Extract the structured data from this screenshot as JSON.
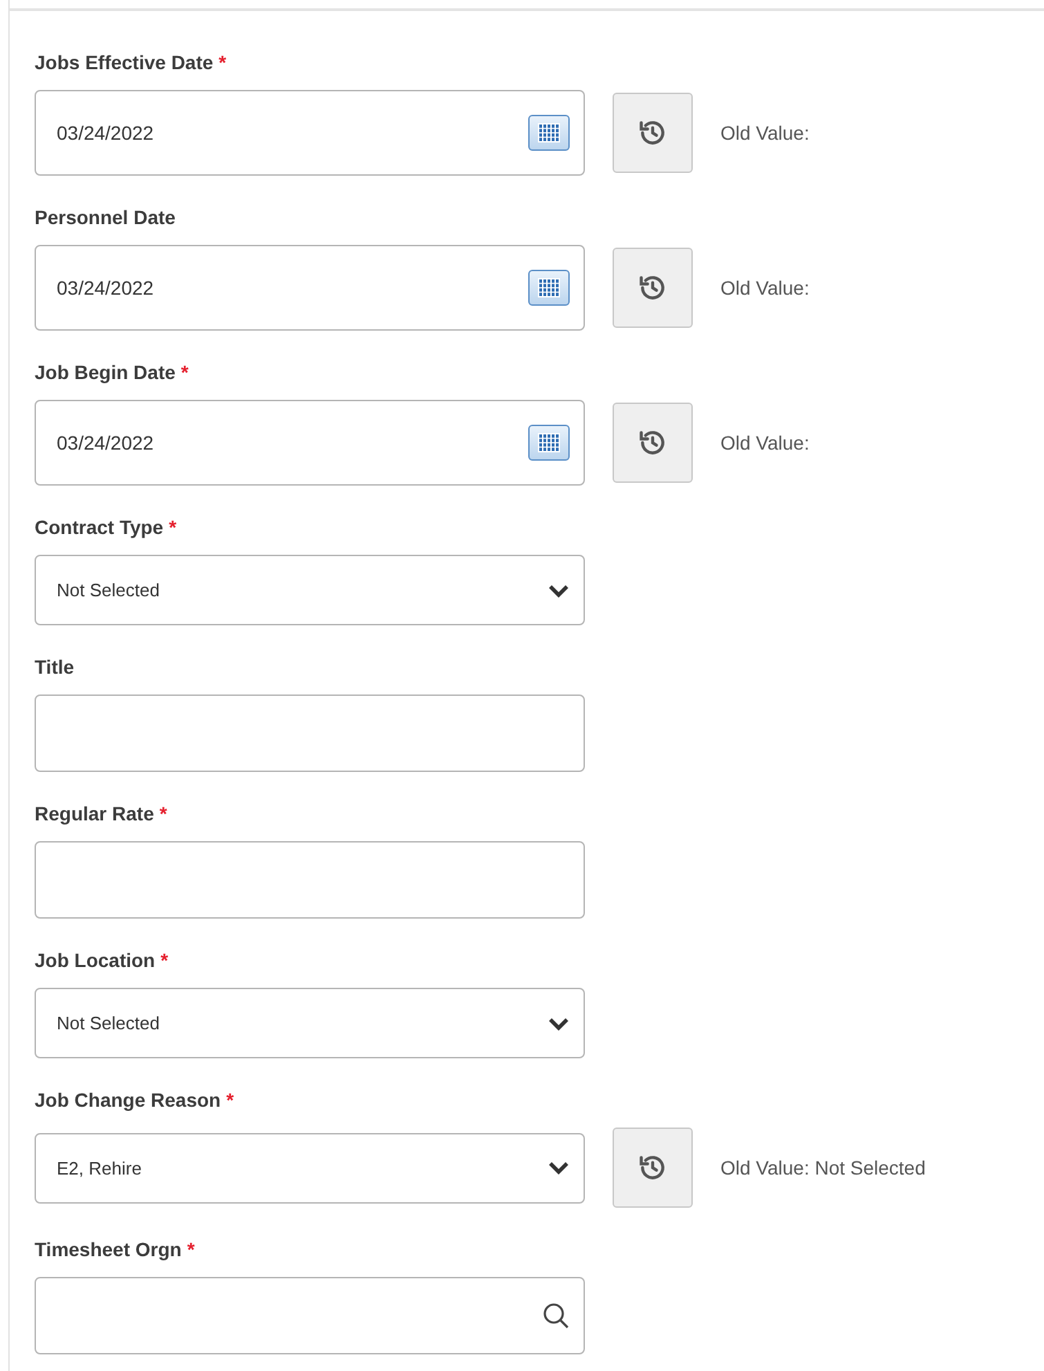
{
  "fields": [
    {
      "label": "Jobs Effective Date",
      "required_mark": "*",
      "kind": "date",
      "value": "03/24/2022",
      "old_value": "Old Value:"
    },
    {
      "label": "Personnel Date",
      "kind": "date",
      "value": "03/24/2022",
      "old_value": "Old Value:"
    },
    {
      "label": "Job Begin Date",
      "required_mark": "*",
      "kind": "date",
      "value": "03/24/2022",
      "old_value": "Old Value:"
    },
    {
      "label": "Contract Type",
      "required_mark": "*",
      "kind": "select",
      "value": "Not Selected"
    },
    {
      "label": "Title",
      "kind": "text"
    },
    {
      "label": "Regular Rate",
      "required_mark": "*",
      "kind": "text"
    },
    {
      "label": "Job Location",
      "required_mark": "*",
      "kind": "select",
      "value": "Not Selected"
    },
    {
      "label": "Job Change Reason",
      "required_mark": "*",
      "kind": "select",
      "value": "E2, Rehire",
      "old_value": "Old Value: Not Selected"
    },
    {
      "label": "Timesheet Orgn",
      "required_mark": "*",
      "kind": "search"
    }
  ]
}
